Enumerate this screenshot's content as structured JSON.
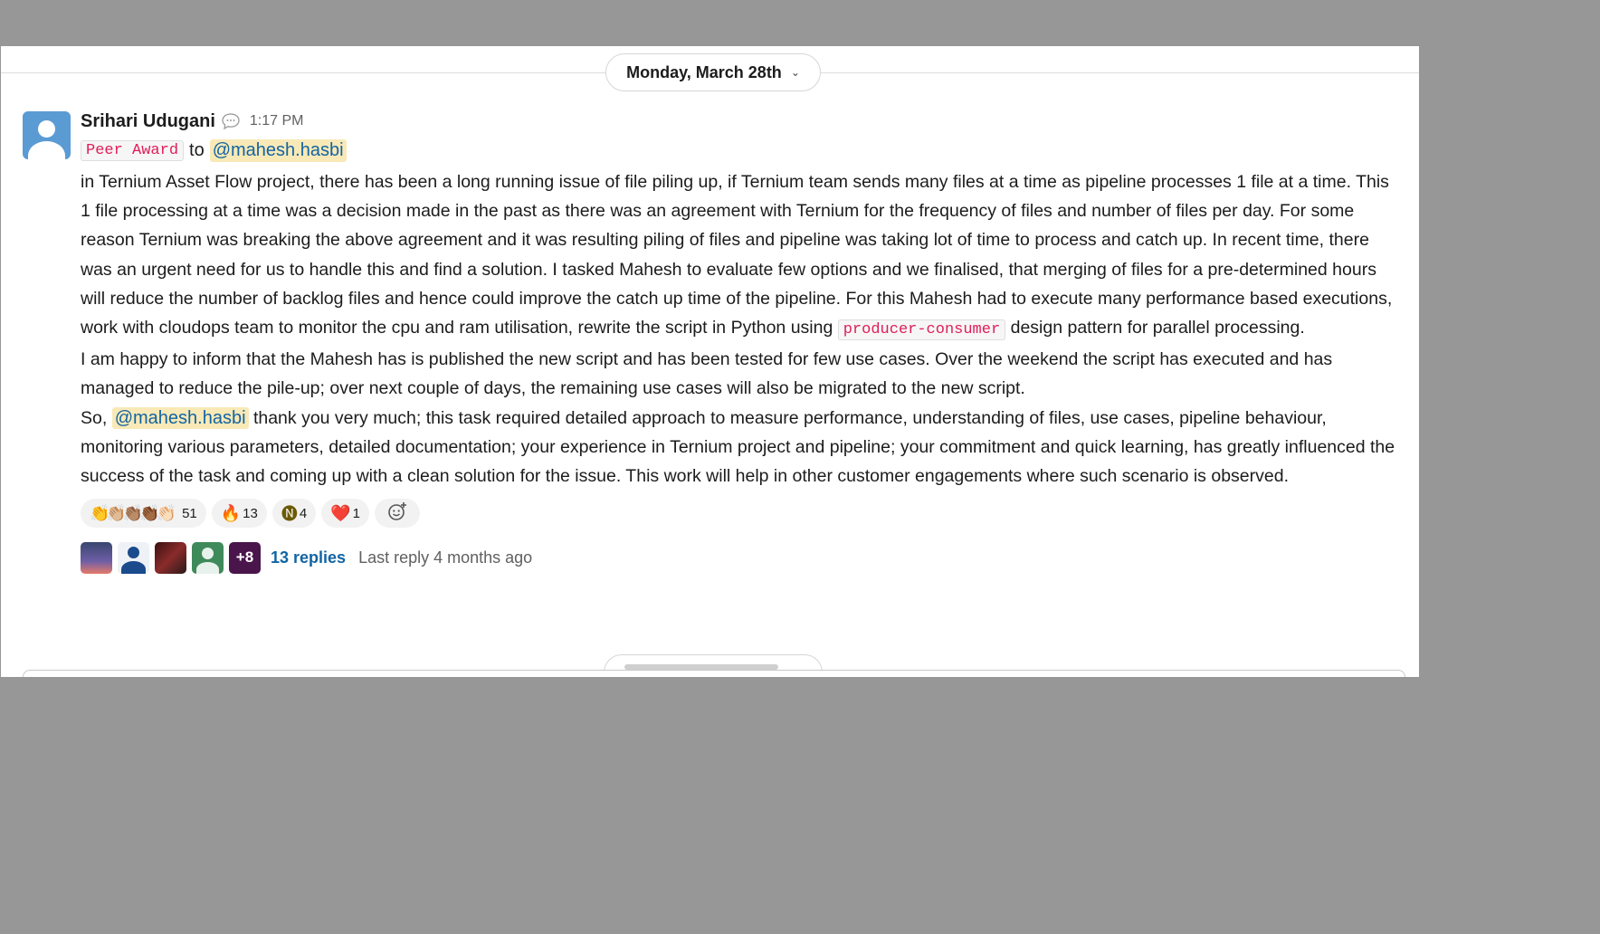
{
  "date_divider": {
    "label": "Monday, March 28th"
  },
  "message": {
    "sender": "Srihari Udugani",
    "time": "1:17 PM",
    "award_tag": "Peer Award",
    "award_to": "to",
    "award_mention": "@mahesh.hasbi",
    "paragraph1_a": "in Ternium Asset Flow project, there has been a long running issue of file piling up, if Ternium team sends many files at a time as pipeline processes 1 file at a time. This 1 file processing at a time was a decision made in the past as there was an agreement with Ternium for the frequency of files and number of files per day. For some reason Ternium was breaking the above agreement and it was resulting piling of files and pipeline was taking lot of time to process and catch up. In recent time, there was an urgent need for us to handle this and find a solution. I tasked Mahesh to evaluate few options and we finalised, that merging of files for a pre-determined hours will reduce the number of backlog files and hence could improve the catch up time of the pipeline. For this Mahesh had to execute many performance based executions, work with cloudops team to monitor the cpu and ram utilisation, rewrite the script in Python using",
    "paragraph1_code": "producer-consumer",
    "paragraph1_b": "design pattern for parallel processing.",
    "paragraph2": "I am happy to inform that the Mahesh has is published the new script and has been tested for few use cases. Over the weekend the script has executed and has managed to reduce the pile-up; over next couple of days, the remaining use cases will also be migrated to the new script.",
    "paragraph3_a": "So,",
    "paragraph3_mention": "@mahesh.hasbi",
    "paragraph3_b": "thank you very much; this task required detailed approach to measure performance, understanding of files, use cases, pipeline behaviour, monitoring various parameters, detailed documentation; your experience in Ternium project and pipeline; your commitment and quick learning, has greatly influenced the success of the task and coming up with a clean solution for the issue. This work will help in other customer engagements where such scenario is observed."
  },
  "reactions": [
    {
      "emoji": "👏👏🏼👏🏽👏🏾👏🏻",
      "count": "51"
    },
    {
      "emoji": "🔥",
      "count": "13"
    },
    {
      "emoji": "🅝",
      "count": "4"
    },
    {
      "emoji": "❤️",
      "count": "1"
    }
  ],
  "thread": {
    "more_avatars": "+8",
    "reply_count": "13 replies",
    "last_reply": "Last reply 4 months ago"
  },
  "colors": {
    "mention_bg": "#f8e9b7",
    "mention_text": "#1264a3",
    "code_text": "#e01e5a",
    "link": "#1264a3",
    "thread_more_bg": "#4a154b"
  },
  "icons": {
    "status": "speech-bubble-icon",
    "date_chevron": "chevron-down-icon",
    "add_reaction": "add-reaction-icon"
  }
}
